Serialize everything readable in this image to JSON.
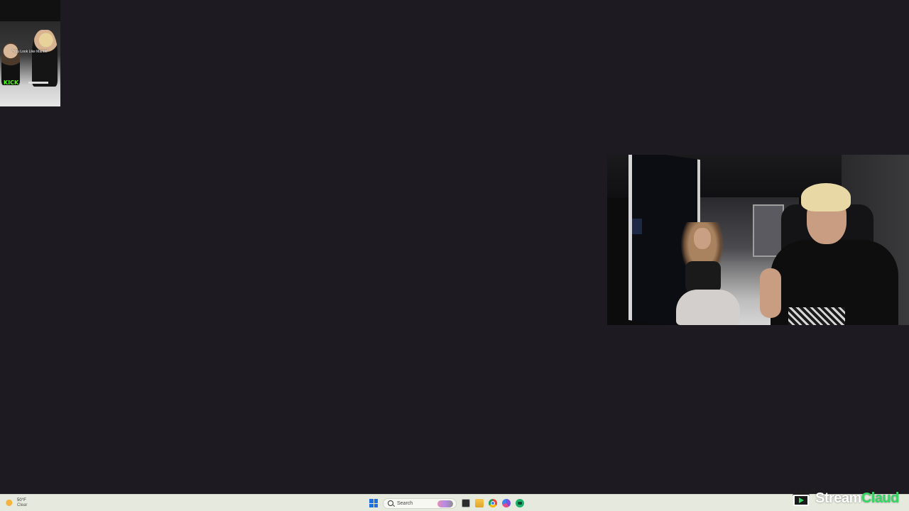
{
  "thumbnail": {
    "caption": "\"You Look Like Marlon\"",
    "platform_label": "KICK"
  },
  "taskbar": {
    "weather": {
      "temperature": "50°F",
      "condition": "Clear",
      "icon": "moon-icon"
    },
    "search": {
      "label": "Search"
    },
    "apps": [
      "start-icon",
      "search-icon",
      "task-view-icon",
      "file-explorer-icon",
      "chrome-icon",
      "browser-icon",
      "app-icon"
    ]
  },
  "watermark": {
    "part1": "Stream",
    "part2": "Claud"
  },
  "colors": {
    "desktop_bg": "#1d1b21",
    "taskbar_bg": "#e6e9dd",
    "accent_green": "#35d764",
    "kick_green": "#53fc18"
  }
}
